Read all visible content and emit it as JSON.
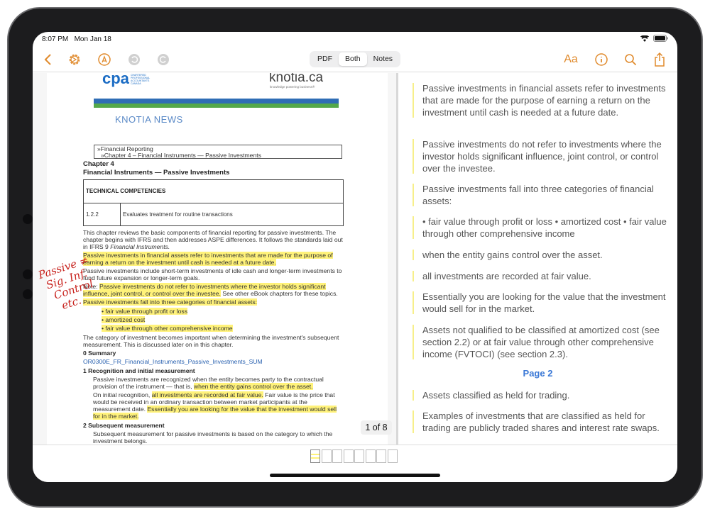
{
  "status": {
    "time": "8:07 PM",
    "date": "Mon Jan 18"
  },
  "toolbar": {
    "left_icons": [
      "back-chevron-icon",
      "settings-gear-icon",
      "markup-pen-icon",
      "undo-icon",
      "redo-icon"
    ],
    "segments": [
      "PDF",
      "Both",
      "Notes"
    ],
    "selected": "Both",
    "font_label": "Aa",
    "right_icons": [
      "info-icon",
      "search-icon",
      "share-icon"
    ],
    "accent": "#e08a2c"
  },
  "pdf": {
    "logo_left": "cpa",
    "logo_left_sub": "CHARTERED PROFESSIONAL ACCOUNTANTS CANADA",
    "logo_right": "knotia.ca",
    "logo_right_sub": "knowledge powering business®",
    "news_title": "KNOTIA NEWS",
    "breadcrumb": [
      "»Financial Reporting",
      "»Chapter 4 – Financial Instruments — Passive Investments"
    ],
    "chapter": "Chapter 4",
    "chapter_title": "Financial Instruments — Passive Investments",
    "table": {
      "header": "TECHNICAL COMPETENCIES",
      "row": [
        "1.2.2",
        "Evaluates treatment for routine transactions"
      ]
    },
    "lines": [
      [
        [
          "This chapter reviews the basic components of financial reporting for passive investments. The",
          0
        ]
      ],
      [
        [
          "chapter begins with IFRS and then addresses ASPE differences. It follows the standards laid out",
          0
        ]
      ],
      [
        [
          "in IFRS 9 ",
          0
        ],
        [
          "Financial Instruments.",
          0
        ]
      ],
      [
        [
          "Passive investments in financial assets refer to investments that are made for the purpose of",
          1
        ]
      ],
      [
        [
          "earning a return on the investment until cash is needed at a future date.",
          1
        ]
      ],
      [
        [
          "Passive investments include short-term investments of idle cash and longer-term investments to",
          0
        ]
      ],
      [
        [
          "fund future expansion or longer-term goals.",
          0
        ]
      ],
      [
        [
          "Note: ",
          0
        ],
        [
          "Passive investments do not refer to investments where the investor holds significant",
          1
        ]
      ],
      [
        [
          "influence, joint control, or control over the investee.",
          1
        ],
        [
          " See other eBook chapters for these topics.",
          0
        ]
      ],
      [
        [
          "Passive investments fall into three categories of financial assets:",
          1
        ]
      ],
      [
        [
          "•      fair value through profit or loss",
          1
        ]
      ],
      [
        [
          "•      amortized cost",
          1
        ]
      ],
      [
        [
          "•      fair value through other comprehensive income",
          1
        ]
      ],
      [
        [
          "The category of investment becomes important when determining the investment's subsequent",
          0
        ]
      ],
      [
        [
          "measurement. This is discussed later on in this chapter.",
          0
        ]
      ],
      [
        [
          "0      Summary",
          2
        ]
      ],
      [
        [
          "OR0300E_FR_Financial_Instruments_Passive_Investments_SUM",
          3
        ]
      ],
      [
        [
          "1      Recognition and initial measurement",
          2
        ]
      ],
      [
        [
          "Passive investments are recognized when the entity becomes party to the contractual",
          0
        ]
      ],
      [
        [
          "provision of the instrument — that is, ",
          0
        ],
        [
          "when the entity gains control over the asset.",
          1
        ]
      ],
      [
        [
          "On initial recognition, ",
          0
        ],
        [
          "all investments are recorded at fair value.",
          1
        ],
        [
          " Fair value is the price that",
          0
        ]
      ],
      [
        [
          "would be received in an ordinary transaction between market participants at the",
          0
        ]
      ],
      [
        [
          "measurement date. ",
          0
        ],
        [
          "Essentially you are looking for the value that the investment would sell",
          1
        ]
      ],
      [
        [
          "for in the market.",
          1
        ]
      ],
      [
        [
          "2      Subsequent measurement",
          2
        ]
      ],
      [
        [
          "Subsequent measurement for passive investments is based on the category to which the",
          0
        ]
      ],
      [
        [
          "investment belongs.",
          0
        ]
      ]
    ],
    "handwriting": [
      "Passive ≠",
      "Sig. Inf.",
      "Control",
      "etc."
    ],
    "page_indicator": "1 of 8",
    "highlight_color": "#fff27a"
  },
  "notes": {
    "items": [
      "Passive investments in financial assets refer to investments that are made for the purpose of earning a return on the investment until cash is needed at a future date.",
      "Passive investments do not refer to investments where the investor holds significant influence, joint control, or control over the investee.",
      "Passive investments fall into three categories of financial assets:",
      "• fair value through profit or loss • amortized cost • fair value through other comprehensive income",
      "when the entity gains control over the asset.",
      "all investments are recorded at fair value.",
      "Essentially you are looking for the value that the investment would sell for in the market.",
      "Assets not qualified to be classified at amortized cost (see section 2.2) or at fair value through other comprehensive income (FVTOCI) (see section 2.3).",
      "Assets classified as held for trading.",
      "Examples of investments that are classified as held for trading are publicly traded shares and interest rate swaps."
    ],
    "page_label": "Page 2",
    "page_color": "#3a78d6"
  },
  "thumbnails": {
    "count": 8,
    "selected": 1
  }
}
